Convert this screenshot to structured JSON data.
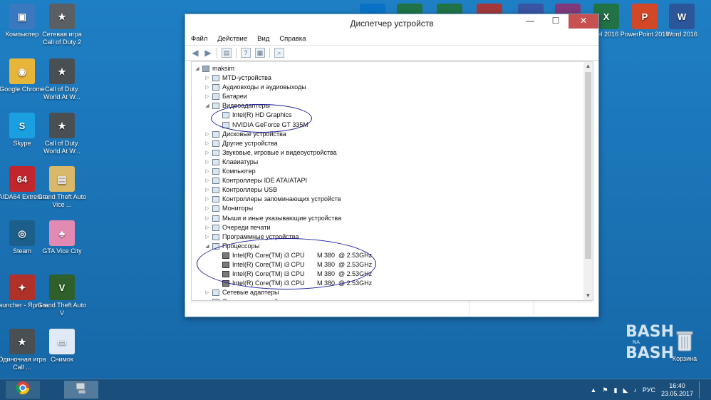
{
  "desktop": {
    "left_icons": [
      {
        "label": "Компьютер",
        "color": "#3a78c0",
        "glyph": "▣"
      },
      {
        "label": "Сетевая игра Call of Duty 2",
        "color": "#5a5f63",
        "glyph": "★"
      },
      {
        "label": "Google Chrome",
        "color": "#e8b53b",
        "glyph": "◉"
      },
      {
        "label": "Call of Duty. World At W...",
        "color": "#4a4f53",
        "glyph": "★"
      },
      {
        "label": "Skype",
        "color": "#1aa0e0",
        "glyph": "S"
      },
      {
        "label": "Call of Duty. World At W...",
        "color": "#4a4f53",
        "glyph": "★"
      },
      {
        "label": "AIDA64 Extreme",
        "color": "#c0262c",
        "glyph": "64"
      },
      {
        "label": "Grand Theft Auto Vice ...",
        "color": "#d9b86a",
        "glyph": "▤"
      },
      {
        "label": "Steam",
        "color": "#1b5f8a",
        "glyph": "◎"
      },
      {
        "label": "GTA Vice City",
        "color": "#e38ab3",
        "glyph": "♣"
      },
      {
        "label": "launcher - Ярлык",
        "color": "#b0302a",
        "glyph": "✦"
      },
      {
        "label": "Grand Theft Auto V",
        "color": "#2f5f2a",
        "glyph": "V"
      },
      {
        "label": "Одиночная игра Call ...",
        "color": "#4a4f53",
        "glyph": "★"
      },
      {
        "label": "Снимок",
        "color": "#dfeaf6",
        "glyph": "▭"
      }
    ],
    "top_icons": [
      {
        "label": "",
        "color": "#0a72c6",
        "glyph": "O"
      },
      {
        "label": "",
        "color": "#217346",
        "glyph": "P"
      },
      {
        "label": "",
        "color": "#217346",
        "glyph": "P"
      },
      {
        "label": "",
        "color": "#a4373a",
        "glyph": "A"
      },
      {
        "label": "",
        "color": "#3955a3",
        "glyph": "V"
      },
      {
        "label": "",
        "color": "#80397b",
        "glyph": "N"
      },
      {
        "label": "cel 2016",
        "color": "#217346",
        "glyph": "X"
      },
      {
        "label": "PowerPoint 2016",
        "color": "#d24726",
        "glyph": "P"
      },
      {
        "label": "Word 2016",
        "color": "#2b579a",
        "glyph": "W"
      }
    ],
    "recycle_bin": "Корзина",
    "watermark": "BASH NA BASH"
  },
  "window": {
    "title": "Диспетчер устройств",
    "min": "—",
    "max": "☐",
    "close": "✕",
    "menu": [
      "Файл",
      "Действие",
      "Вид",
      "Справка"
    ]
  },
  "tree": {
    "root": "maksim",
    "items": [
      {
        "label": "MTD-устройства",
        "level": 1,
        "exp": "▷"
      },
      {
        "label": "Аудиовходы и аудиовыходы",
        "level": 1,
        "exp": "▷"
      },
      {
        "label": "Батареи",
        "level": 1,
        "exp": "▷"
      },
      {
        "label": "Видеоадаптеры",
        "level": 1,
        "exp": "◢"
      },
      {
        "label": "Intel(R) HD Graphics",
        "level": 2,
        "exp": ""
      },
      {
        "label": "NVIDIA GeForce GT 335M",
        "level": 2,
        "exp": ""
      },
      {
        "label": "Дисковые устройства",
        "level": 1,
        "exp": "▷"
      },
      {
        "label": "Другие устройства",
        "level": 1,
        "exp": "▷"
      },
      {
        "label": "Звуковые, игровые и видеоустройства",
        "level": 1,
        "exp": "▷"
      },
      {
        "label": "Клавиатуры",
        "level": 1,
        "exp": "▷"
      },
      {
        "label": "Компьютер",
        "level": 1,
        "exp": "▷"
      },
      {
        "label": "Контроллеры IDE ATA/ATAPI",
        "level": 1,
        "exp": "▷"
      },
      {
        "label": "Контроллеры USB",
        "level": 1,
        "exp": "▷"
      },
      {
        "label": "Контроллеры запоминающих устройств",
        "level": 1,
        "exp": "▷"
      },
      {
        "label": "Мониторы",
        "level": 1,
        "exp": "▷"
      },
      {
        "label": "Мыши и иные указывающие устройства",
        "level": 1,
        "exp": "▷"
      },
      {
        "label": "Очереди печати",
        "level": 1,
        "exp": "▷"
      },
      {
        "label": "Программные устройства",
        "level": 1,
        "exp": "▷"
      },
      {
        "label": "Процессоры",
        "level": 1,
        "exp": "◢"
      },
      {
        "label": "Intel(R) Core(TM) i3 CPU       M 380  @ 2.53GHz",
        "level": 2,
        "exp": "",
        "cpu": true
      },
      {
        "label": "Intel(R) Core(TM) i3 CPU       M 380  @ 2.53GHz",
        "level": 2,
        "exp": "",
        "cpu": true
      },
      {
        "label": "Intel(R) Core(TM) i3 CPU       M 380  @ 2.53GHz",
        "level": 2,
        "exp": "",
        "cpu": true
      },
      {
        "label": "Intel(R) Core(TM) i3 CPU       M 380  @ 2.53GHz",
        "level": 2,
        "exp": "",
        "cpu": true
      },
      {
        "label": "Сетевые адаптеры",
        "level": 1,
        "exp": "▷"
      },
      {
        "label": "Системные устройства",
        "level": 1,
        "exp": "▷"
      }
    ]
  },
  "taskbar": {
    "lang": "РУС",
    "time": "16:40",
    "date": "23.05.2017"
  }
}
